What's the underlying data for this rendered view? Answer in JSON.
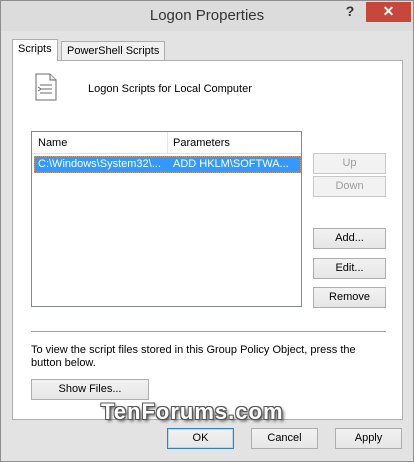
{
  "window": {
    "title": "Logon Properties",
    "help_label": "?",
    "close_label": "✕"
  },
  "tabs": [
    {
      "label": "Scripts",
      "active": true
    },
    {
      "label": "PowerShell Scripts",
      "active": false
    }
  ],
  "scripts_panel": {
    "icon": "script-file-icon",
    "heading": "Logon Scripts for Local Computer",
    "list": {
      "columns": [
        "Name",
        "Parameters"
      ],
      "rows": [
        {
          "name": "C:\\Windows\\System32\\...",
          "parameters": "ADD HKLM\\SOFTWA...",
          "selected": true
        }
      ]
    },
    "buttons": {
      "up": "Up",
      "down": "Down",
      "add": "Add...",
      "edit": "Edit...",
      "remove": "Remove"
    },
    "info_text": "To view the script files stored in this Group Policy Object, press the button below.",
    "show_files": "Show Files..."
  },
  "watermark": "TenForums.com",
  "footer": {
    "ok": "OK",
    "cancel": "Cancel",
    "apply": "Apply"
  },
  "colors": {
    "selection": "#3399ff",
    "close_button": "#c7483a"
  }
}
